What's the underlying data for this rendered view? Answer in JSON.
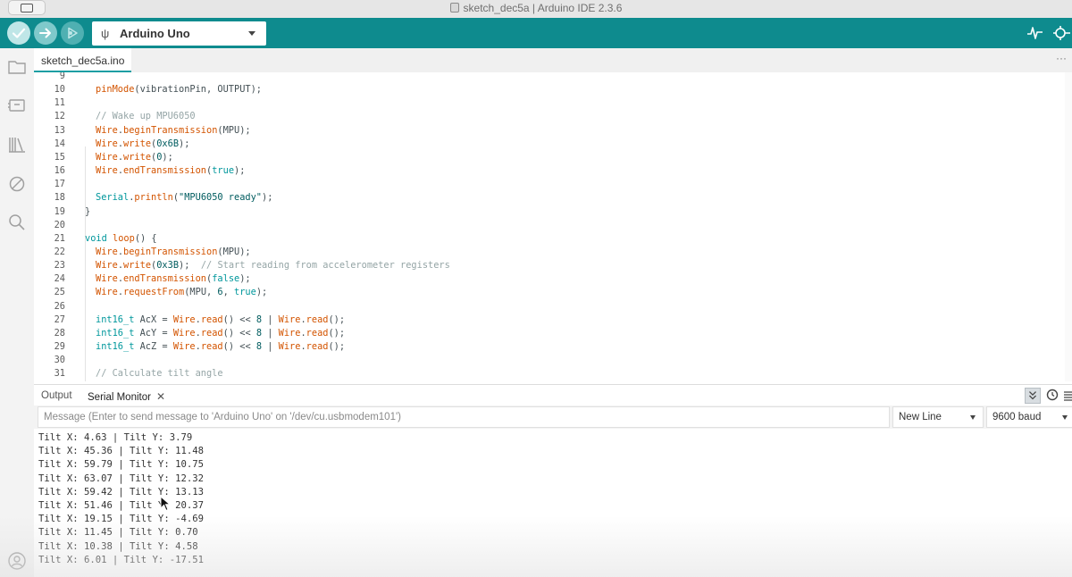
{
  "window": {
    "title": "sketch_dec5a | Arduino IDE 2.3.6"
  },
  "toolbar": {
    "verify_icon": "checkmark-icon",
    "upload_icon": "arrow-right-icon",
    "debug_icon": "debug-icon",
    "board_name": "Arduino Uno",
    "board_icon": "usb-icon",
    "plotter_icon": "serial-plotter-icon",
    "monitor_icon": "serial-monitor-icon",
    "accent_color": "#0e8b8e"
  },
  "sidebar": {
    "items": [
      "folder-icon",
      "board-manager-icon",
      "library-icon",
      "debug-off-icon",
      "search-icon",
      "profile-icon"
    ]
  },
  "editor": {
    "tab": "sketch_dec5a.ino",
    "more": "···",
    "lines": [
      {
        "n": "9",
        "parts": []
      },
      {
        "n": "10",
        "parts": [
          [
            "kw",
            "pinMode"
          ],
          [
            "",
            "(vibrationPin, OUTPUT);"
          ]
        ]
      },
      {
        "n": "11",
        "parts": []
      },
      {
        "n": "12",
        "parts": [
          [
            "cm",
            "// Wake up MPU6050"
          ]
        ]
      },
      {
        "n": "13",
        "parts": [
          [
            "kw",
            "Wire"
          ],
          [
            "",
            "."
          ],
          [
            "kw",
            "beginTransmission"
          ],
          [
            "",
            "(MPU);"
          ]
        ]
      },
      {
        "n": "14",
        "parts": [
          [
            "kw",
            "Wire"
          ],
          [
            "",
            "."
          ],
          [
            "kw",
            "write"
          ],
          [
            "",
            "("
          ],
          [
            "num",
            "0x6B"
          ],
          [
            "",
            ");"
          ]
        ]
      },
      {
        "n": "15",
        "parts": [
          [
            "kw",
            "Wire"
          ],
          [
            "",
            "."
          ],
          [
            "kw",
            "write"
          ],
          [
            "",
            "("
          ],
          [
            "num",
            "0"
          ],
          [
            "",
            ");"
          ]
        ]
      },
      {
        "n": "16",
        "parts": [
          [
            "kw",
            "Wire"
          ],
          [
            "",
            "."
          ],
          [
            "kw",
            "endTransmission"
          ],
          [
            "",
            "("
          ],
          [
            "ty",
            "true"
          ],
          [
            "",
            ");"
          ]
        ]
      },
      {
        "n": "17",
        "parts": []
      },
      {
        "n": "18",
        "parts": [
          [
            "ty",
            "Serial"
          ],
          [
            "",
            "."
          ],
          [
            "kw",
            "println"
          ],
          [
            "",
            "("
          ],
          [
            "str",
            "\"MPU6050 ready\""
          ],
          [
            "",
            ");"
          ]
        ]
      },
      {
        "n": "19",
        "parts": [
          [
            "",
            "}"
          ]
        ],
        "outdent": true
      },
      {
        "n": "20",
        "parts": []
      },
      {
        "n": "21",
        "parts": [
          [
            "ty",
            "void"
          ],
          [
            "",
            " "
          ],
          [
            "kw",
            "loop"
          ],
          [
            "",
            "() {"
          ]
        ],
        "outdent": true
      },
      {
        "n": "22",
        "parts": [
          [
            "kw",
            "Wire"
          ],
          [
            "",
            "."
          ],
          [
            "kw",
            "beginTransmission"
          ],
          [
            "",
            "(MPU);"
          ]
        ]
      },
      {
        "n": "23",
        "parts": [
          [
            "kw",
            "Wire"
          ],
          [
            "",
            "."
          ],
          [
            "kw",
            "write"
          ],
          [
            "",
            "("
          ],
          [
            "num",
            "0x3B"
          ],
          [
            "",
            ");  "
          ],
          [
            "cm",
            "// Start reading from accelerometer registers"
          ]
        ]
      },
      {
        "n": "24",
        "parts": [
          [
            "kw",
            "Wire"
          ],
          [
            "",
            "."
          ],
          [
            "kw",
            "endTransmission"
          ],
          [
            "",
            "("
          ],
          [
            "ty",
            "false"
          ],
          [
            "",
            ");"
          ]
        ]
      },
      {
        "n": "25",
        "parts": [
          [
            "kw",
            "Wire"
          ],
          [
            "",
            "."
          ],
          [
            "kw",
            "requestFrom"
          ],
          [
            "",
            "(MPU, "
          ],
          [
            "num",
            "6"
          ],
          [
            "",
            ", "
          ],
          [
            "ty",
            "true"
          ],
          [
            "",
            ");"
          ]
        ]
      },
      {
        "n": "26",
        "parts": []
      },
      {
        "n": "27",
        "parts": [
          [
            "ty",
            "int16_t"
          ],
          [
            "",
            " AcX = "
          ],
          [
            "kw",
            "Wire"
          ],
          [
            "",
            "."
          ],
          [
            "kw",
            "read"
          ],
          [
            "",
            "() << "
          ],
          [
            "num",
            "8"
          ],
          [
            "",
            " | "
          ],
          [
            "kw",
            "Wire"
          ],
          [
            "",
            "."
          ],
          [
            "kw",
            "read"
          ],
          [
            "",
            "();"
          ]
        ]
      },
      {
        "n": "28",
        "parts": [
          [
            "ty",
            "int16_t"
          ],
          [
            "",
            " AcY = "
          ],
          [
            "kw",
            "Wire"
          ],
          [
            "",
            "."
          ],
          [
            "kw",
            "read"
          ],
          [
            "",
            "() << "
          ],
          [
            "num",
            "8"
          ],
          [
            "",
            " | "
          ],
          [
            "kw",
            "Wire"
          ],
          [
            "",
            "."
          ],
          [
            "kw",
            "read"
          ],
          [
            "",
            "();"
          ]
        ]
      },
      {
        "n": "29",
        "parts": [
          [
            "ty",
            "int16_t"
          ],
          [
            "",
            " AcZ = "
          ],
          [
            "kw",
            "Wire"
          ],
          [
            "",
            "."
          ],
          [
            "kw",
            "read"
          ],
          [
            "",
            "() << "
          ],
          [
            "num",
            "8"
          ],
          [
            "",
            " | "
          ],
          [
            "kw",
            "Wire"
          ],
          [
            "",
            "."
          ],
          [
            "kw",
            "read"
          ],
          [
            "",
            "();"
          ]
        ]
      },
      {
        "n": "30",
        "parts": []
      },
      {
        "n": "31",
        "parts": [
          [
            "cm",
            "// Calculate tilt angle"
          ]
        ]
      }
    ]
  },
  "panel": {
    "tab_output": "Output",
    "tab_serial": "Serial Monitor",
    "close": "✕",
    "message_placeholder": "Message (Enter to send message to 'Arduino Uno' on '/dev/cu.usbmodem101')",
    "line_ending": "New Line",
    "baud": "9600 baud",
    "serial_lines": [
      "Tilt X: 4.63 | Tilt Y: 3.79",
      "Tilt X: 45.36 | Tilt Y: 11.48",
      "Tilt X: 59.79 | Tilt Y: 10.75",
      "Tilt X: 63.07 | Tilt Y: 12.32",
      "Tilt X: 59.42 | Tilt Y: 13.13",
      "Tilt X: 51.46 | Tilt Y: 20.37",
      "Tilt X: 19.15 | Tilt Y: -4.69",
      "Tilt X: 11.45 | Tilt Y: 0.70",
      "Tilt X: 10.38 | Tilt Y: 4.58",
      "Tilt X: 6.01 | Tilt Y: -17.51"
    ]
  }
}
